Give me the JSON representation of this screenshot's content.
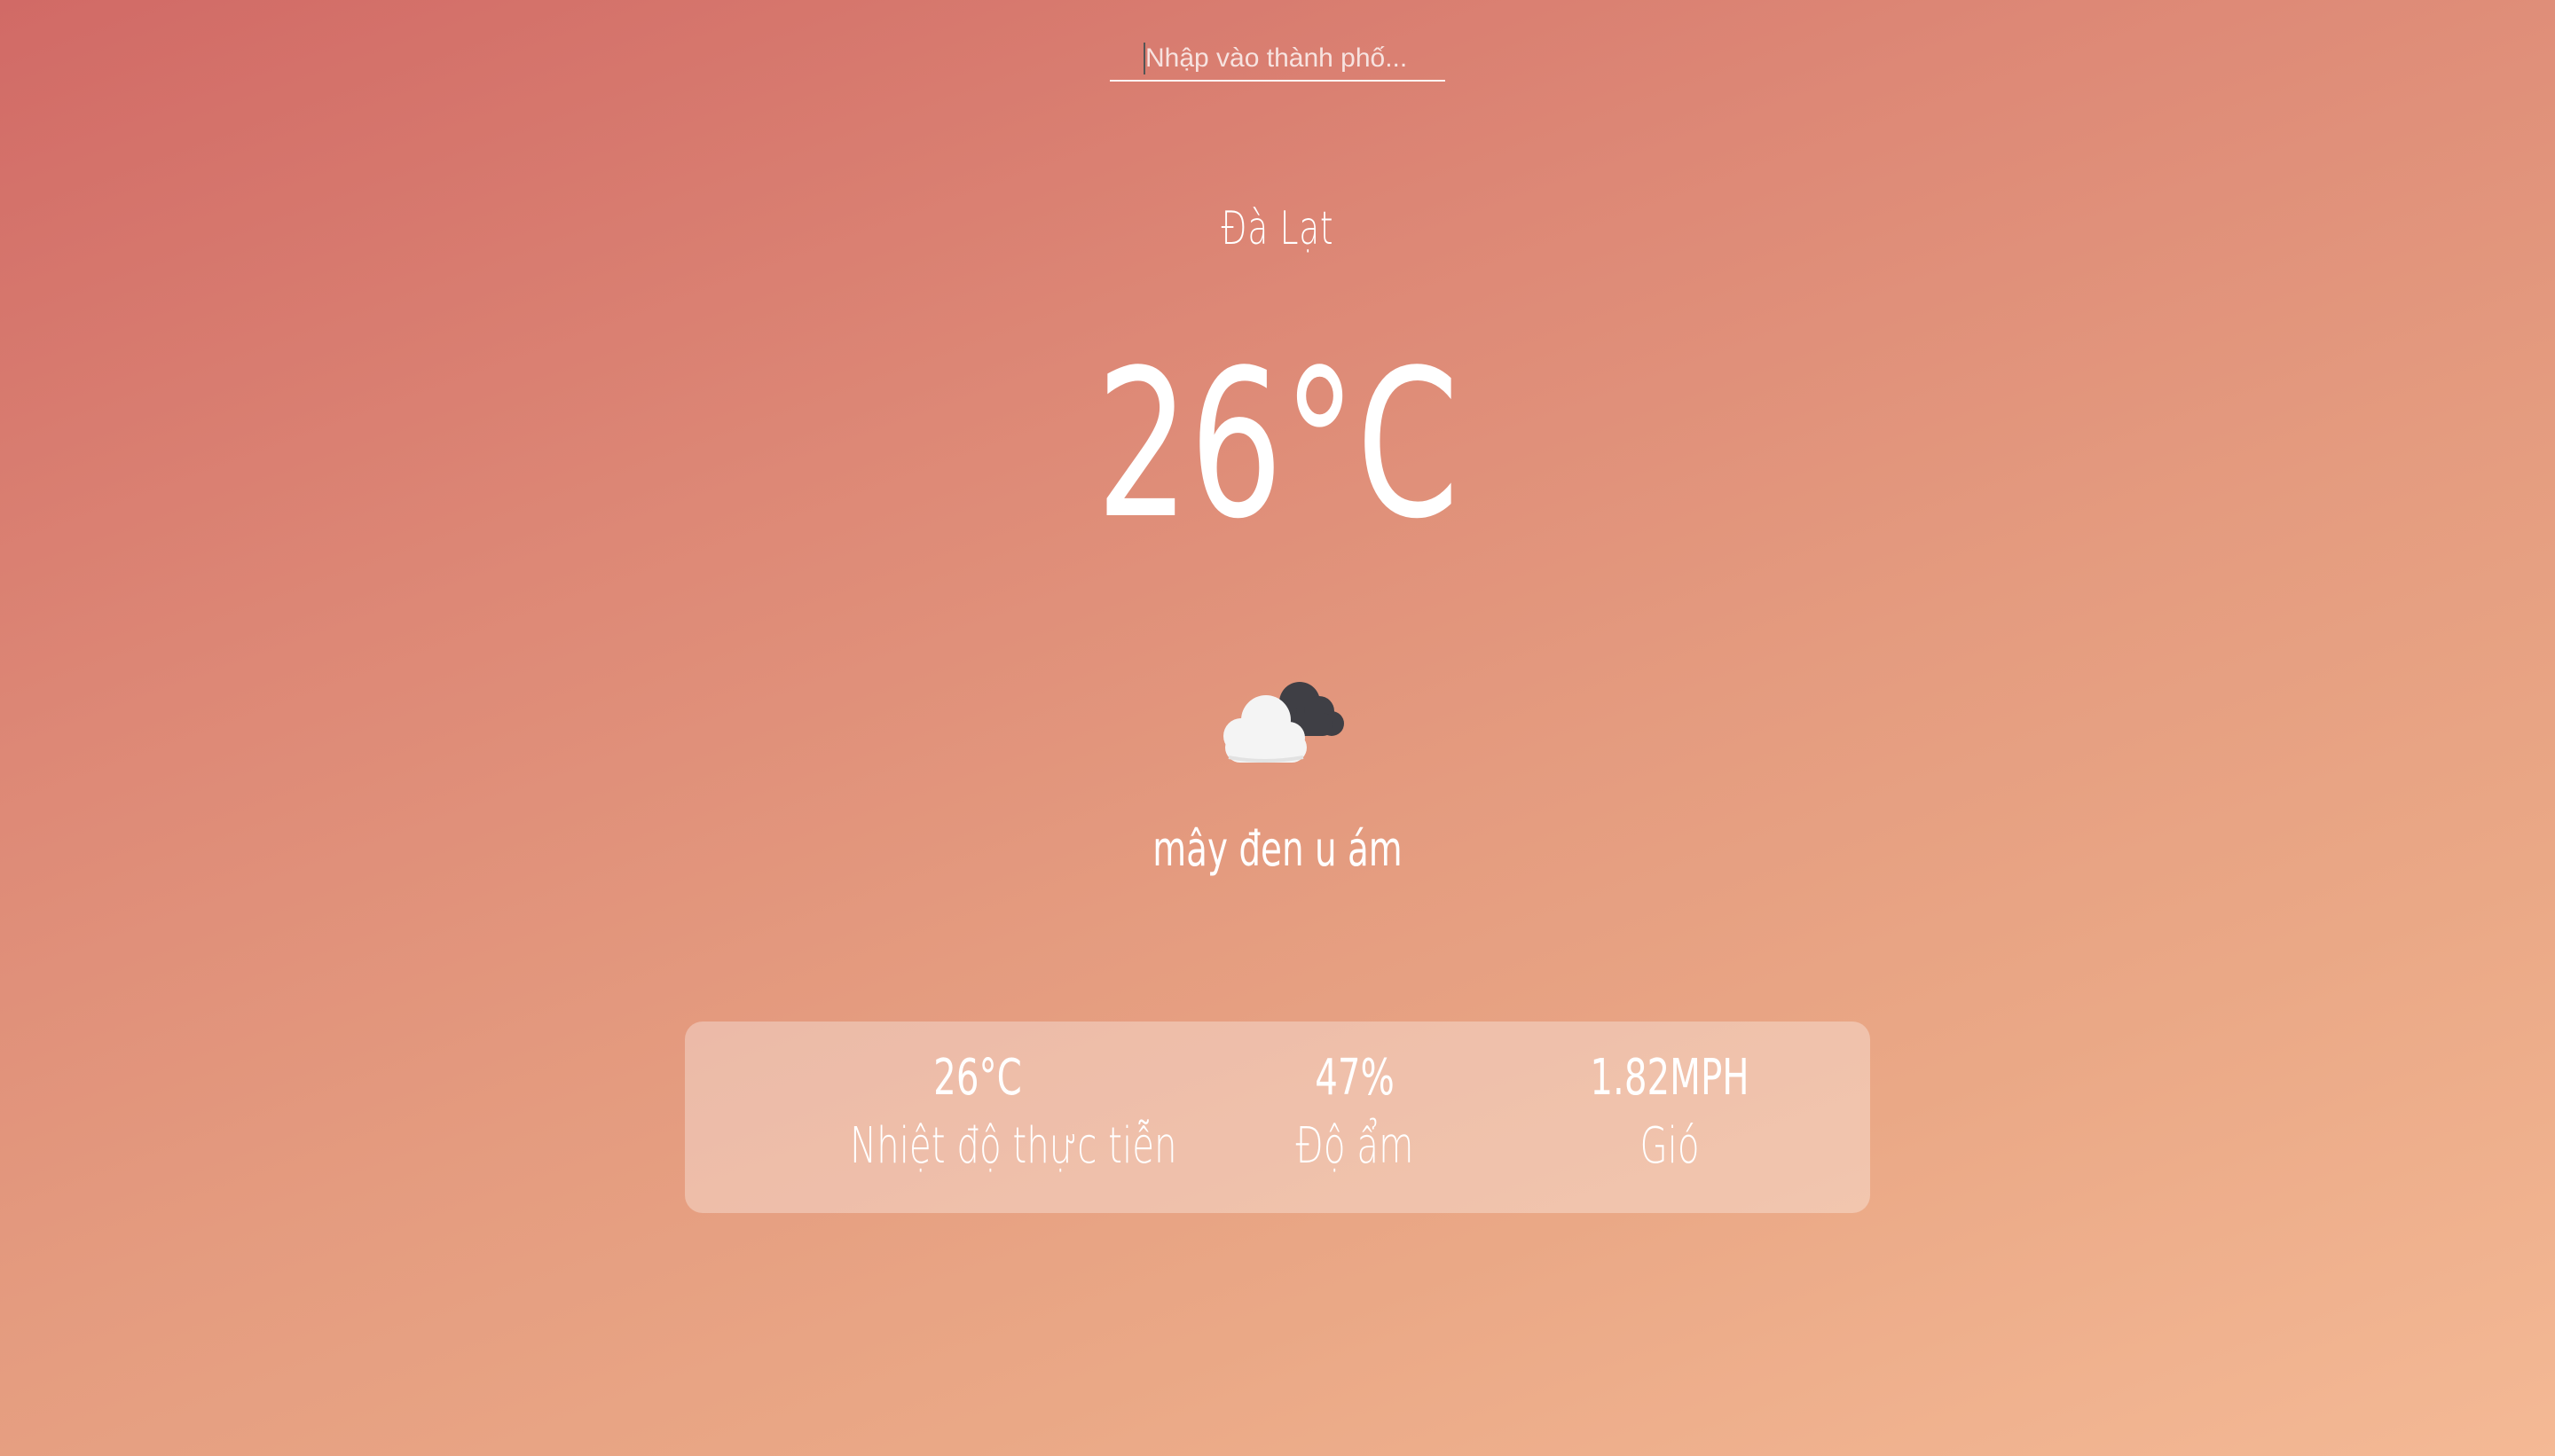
{
  "search": {
    "placeholder": "Nhập vào thành phố..."
  },
  "weather": {
    "city": "Đà Lạt",
    "temperature": "26°C",
    "icon": "overcast-clouds-icon",
    "description": "mây đen u ám"
  },
  "details": [
    {
      "value": "26°C",
      "label": "Nhiệt độ thực tiễn"
    },
    {
      "value": "47%",
      "label": "Độ ẩm"
    },
    {
      "value": "1.82MPH",
      "label": "Gió"
    }
  ],
  "colors": {
    "gradient_start": "#d16a66",
    "gradient_end": "#f4b995",
    "text": "#ffffff"
  }
}
